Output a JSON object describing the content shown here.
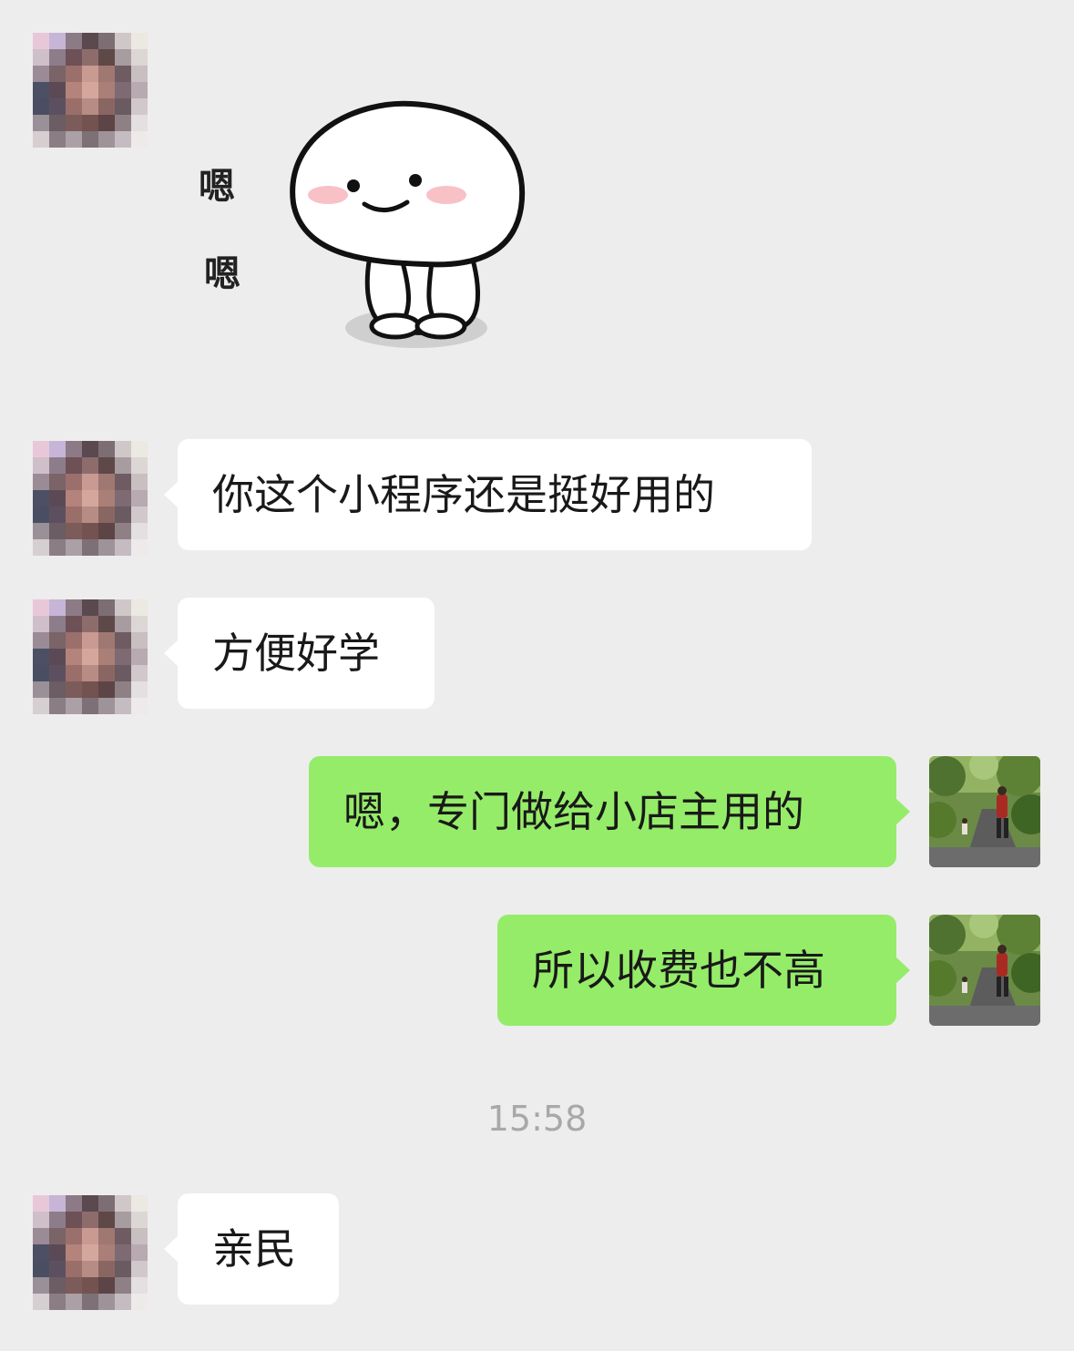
{
  "sticker": {
    "text_1": "嗯",
    "text_2": "嗯",
    "name": "smiling-dumpling-sticker"
  },
  "messages": [
    {
      "side": "in",
      "text": "你这个小程序还是挺好用的"
    },
    {
      "side": "in",
      "text": "方便好学"
    },
    {
      "side": "out",
      "text": "嗯，专门做给小店主用的"
    },
    {
      "side": "out",
      "text": "所以收费也不高"
    },
    {
      "side": "in",
      "text": "亲民"
    }
  ],
  "timestamp": "15:58",
  "colors": {
    "background": "#ededed",
    "incoming_bubble": "#ffffff",
    "outgoing_bubble": "#95ec69"
  }
}
